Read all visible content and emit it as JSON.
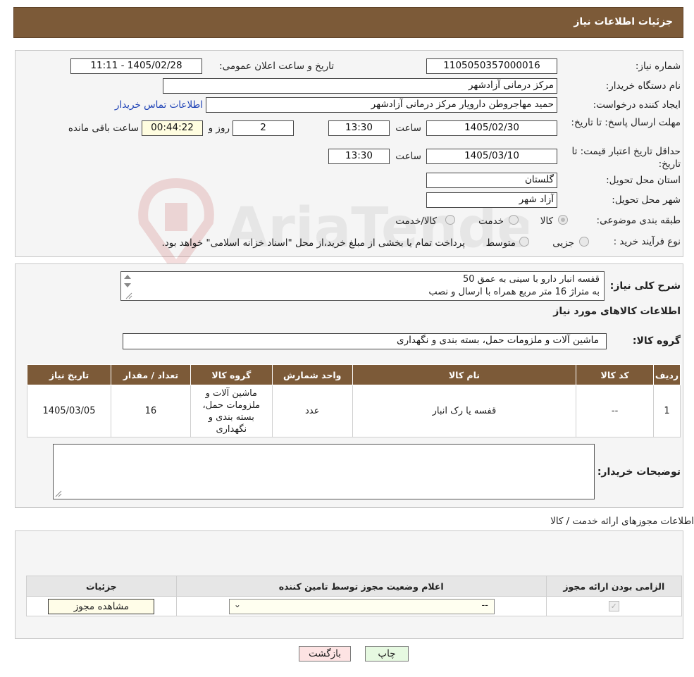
{
  "header": {
    "title": "جزئیات اطلاعات نیاز"
  },
  "form": {
    "need_number_label": "شماره نیاز:",
    "need_number": "1105050357000016",
    "announce_label": "تاریخ و ساعت اعلان عمومی:",
    "announce_value": "1405/02/28 - 11:11",
    "buyer_org_label": "نام دستگاه خریدار:",
    "buyer_org": "مرکز درمانی آزادشهر",
    "creator_label": "ایجاد کننده درخواست:",
    "creator": "حمید مهاجروطن دارویار مرکز درمانی آزادشهر",
    "contact_link": "اطلاعات تماس خریدار",
    "deadline_label": "مهلت ارسال پاسخ: تا تاریخ:",
    "deadline_date": "1405/02/30",
    "time_label": "ساعت",
    "deadline_time": "13:30",
    "days_value": "2",
    "days_label": "روز و",
    "remaining_time": "00:44:22",
    "remaining_label": "ساعت باقی مانده",
    "validity_label": "حداقل تاریخ اعتبار قیمت: تا تاریخ:",
    "validity_date": "1405/03/10",
    "validity_time": "13:30",
    "province_label": "استان محل تحویل:",
    "province": "گلستان",
    "city_label": "شهر محل تحویل:",
    "city": "آزاد شهر",
    "category_label": "طبقه بندی موضوعی:",
    "category_options": [
      "کالا",
      "خدمت",
      "کالا/خدمت"
    ],
    "process_label": "نوع فرآیند خرید :",
    "process_options": [
      "جزیی",
      "متوسط"
    ],
    "process_note": "پرداخت تمام یا بخشی از مبلغ خرید،از محل \"اسناد خزانه اسلامی\" خواهد بود."
  },
  "details": {
    "summary_label": "شرح کلی نیاز:",
    "summary_line1": "قفسه انبار دارو با سینی به عمق 50",
    "summary_line2": "به متراژ 16 متر مربع همراه با ارسال و نصب",
    "goods_info_title": "اطلاعات کالاهای مورد نیاز",
    "goods_group_label": "گروه کالا:",
    "goods_group": "ماشین آلات و ملزومات حمل، بسته بندی و نگهداری",
    "table_headers": [
      "ردیف",
      "کد کالا",
      "نام کالا",
      "واحد شمارش",
      "گروه کالا",
      "تعداد / مقدار",
      "تاریخ نیاز"
    ],
    "rows": [
      {
        "row": "1",
        "code": "--",
        "name": "قفسه یا رک انبار",
        "unit": "عدد",
        "group": "ماشین آلات و ملزومات حمل، بسته بندی و نگهداری",
        "qty": "16",
        "date": "1405/03/05"
      }
    ],
    "buyer_notes_label": "توضیحات خریدار:"
  },
  "permits": {
    "title": "اطلاعات مجوزهای ارائه خدمت / کالا",
    "headers": [
      "الزامی بودن ارائه مجوز",
      "اعلام وضعیت مجوز توسط تامین کننده",
      "جزئیات"
    ],
    "select_value": "--",
    "view_button": "مشاهده مجوز"
  },
  "footer": {
    "back_button": "بازگشت",
    "print_button": "چاپ"
  },
  "watermark_text": "AriaTender.neT"
}
